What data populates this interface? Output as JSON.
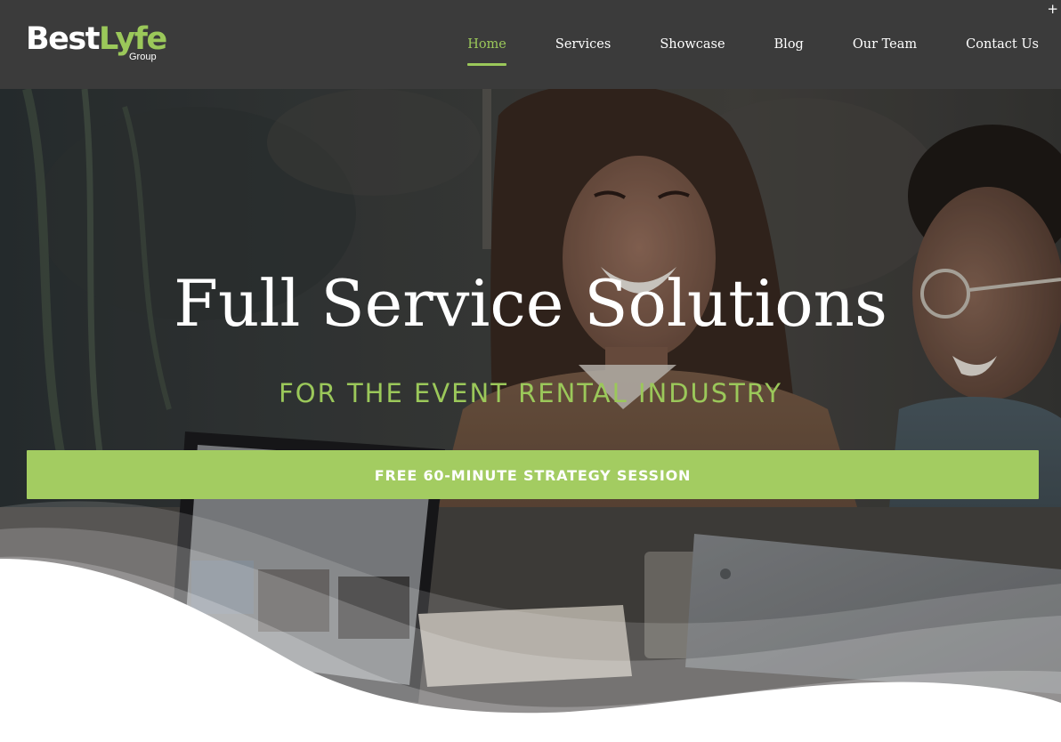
{
  "header": {
    "logo": {
      "text_primary": "Best",
      "text_accent": "Lyfe",
      "tagline": "Group"
    },
    "nav": [
      {
        "label": "Home",
        "active": true
      },
      {
        "label": "Services",
        "active": false
      },
      {
        "label": "Showcase",
        "active": false
      },
      {
        "label": "Blog",
        "active": false
      },
      {
        "label": "Our Team",
        "active": false
      },
      {
        "label": "Contact Us",
        "active": false
      }
    ],
    "corner_symbol": "+"
  },
  "hero": {
    "title": "Full Service Solutions",
    "subtitle": "FOR THE EVENT RENTAL INDUSTRY",
    "cta_label": "FREE 60-MINUTE STRATEGY SESSION",
    "background_image": "photo of two people laughing at a table with laptops"
  },
  "colors": {
    "header_bg": "#3b3b3b",
    "accent": "#9bc85a",
    "button_bg": "#a3cc61",
    "text_light": "#ffffff"
  }
}
